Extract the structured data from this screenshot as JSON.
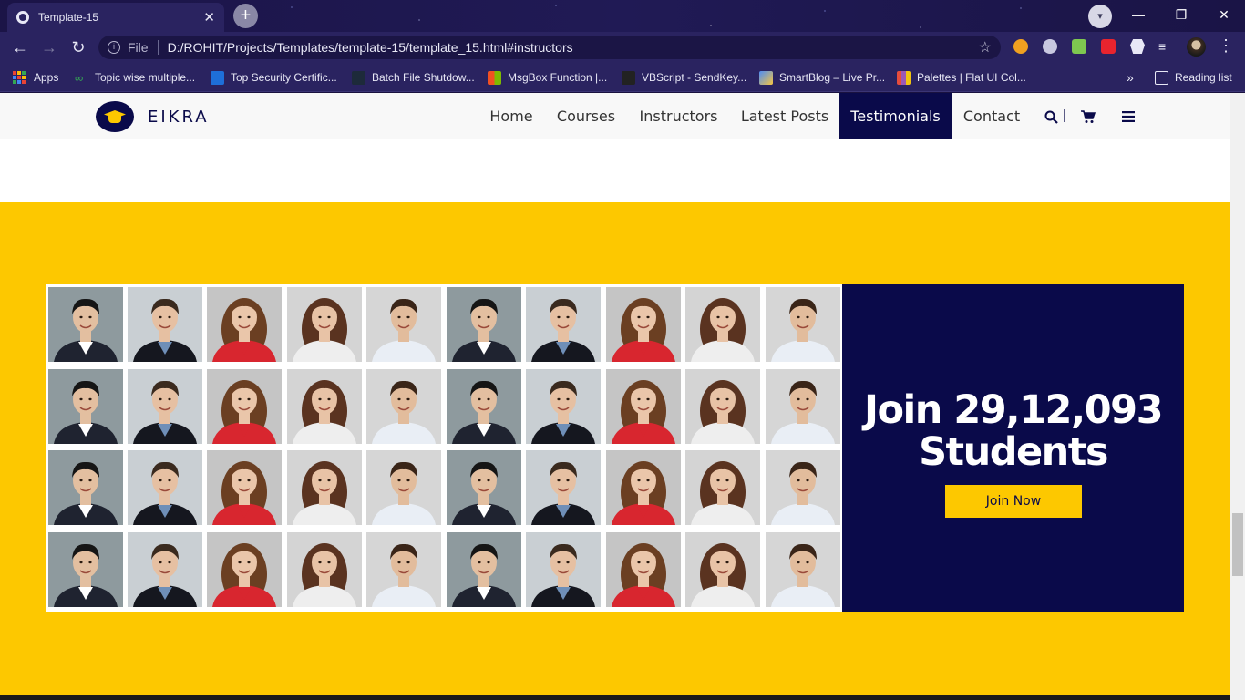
{
  "browser": {
    "tab_title": "Template-15",
    "tab_close": "✕",
    "new_tab": "+",
    "omnibox_file_label": "File",
    "url": "D:/ROHIT/Projects/Templates/template-15/template_15.html#instructors",
    "bookmarks": [
      {
        "label": "Apps",
        "icon_color": "#ea4335"
      },
      {
        "label": "Topic wise multiple...",
        "icon_color": "#34a853"
      },
      {
        "label": "Top Security Certific...",
        "icon_color": "#1e6fd9"
      },
      {
        "label": "Batch File Shutdow...",
        "icon_color": "#1d2a3a"
      },
      {
        "label": "MsgBox Function |...",
        "icon_color": "#f25022"
      },
      {
        "label": "VBScript - SendKey...",
        "icon_color": "#222222"
      },
      {
        "label": "SmartBlog – Live Pr...",
        "icon_color": "#4f8df5"
      },
      {
        "label": "Palettes | Flat UI Col...",
        "icon_color": "#e74c3c"
      }
    ],
    "more_bookmarks": "»",
    "reading_list": "Reading list"
  },
  "site": {
    "logo_text": "EIKRA",
    "nav": [
      {
        "label": "Home",
        "active": false
      },
      {
        "label": "Courses",
        "active": false
      },
      {
        "label": "Instructors",
        "active": false
      },
      {
        "label": "Latest Posts",
        "active": false
      },
      {
        "label": "Testimonials",
        "active": true
      },
      {
        "label": "Contact",
        "active": false
      }
    ],
    "search_icon": "search-icon",
    "divider": "|",
    "cart_icon": "cart-icon",
    "menu_icon": "hamburger-icon",
    "accent_color": "#fdc800",
    "brand_color": "#0a0a4a"
  },
  "cta": {
    "title_line1": "Join 29,12,093",
    "title_line2": "Students",
    "button_label": "Join Now"
  },
  "photo_grid": {
    "rows": 4,
    "cols": 10,
    "faces": [
      "man-in-suit",
      "man-in-blazer",
      "woman-in-red",
      "woman-smiling",
      "man-white-shirt",
      "man-in-suit",
      "man-in-blazer",
      "woman-in-red",
      "woman-smiling",
      "man-white-shirt"
    ]
  }
}
